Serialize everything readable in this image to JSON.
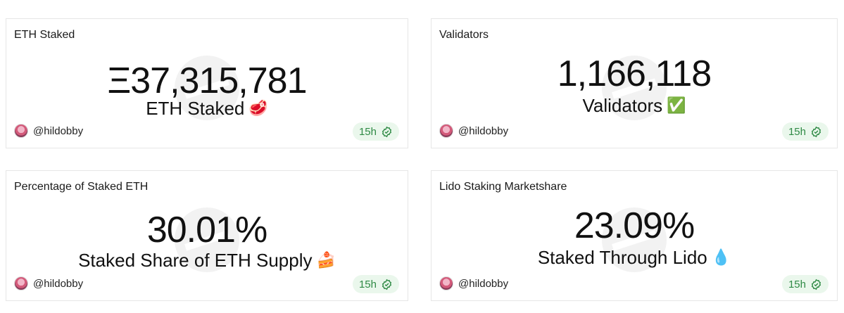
{
  "cards": [
    {
      "title": "ETH Staked",
      "value": "Ξ37,315,781",
      "subtitle": "ETH Staked",
      "emoji": "🥩",
      "author": "@hildobby",
      "age": "15h"
    },
    {
      "title": "Validators",
      "value": "1,166,118",
      "subtitle": "Validators",
      "emoji": "✅",
      "author": "@hildobby",
      "age": "15h"
    },
    {
      "title": "Percentage of Staked ETH",
      "value": "30.01%",
      "subtitle": "Staked Share of ETH Supply",
      "emoji": "🍰",
      "author": "@hildobby",
      "age": "15h"
    },
    {
      "title": "Lido Staking Marketshare",
      "value": "23.09%",
      "subtitle": "Staked Through Lido",
      "emoji": "💧",
      "author": "@hildobby",
      "age": "15h"
    }
  ],
  "colors": {
    "badge_bg": "#eaf7ec",
    "badge_text": "#2f8a45",
    "border": "#e6e6e6"
  }
}
